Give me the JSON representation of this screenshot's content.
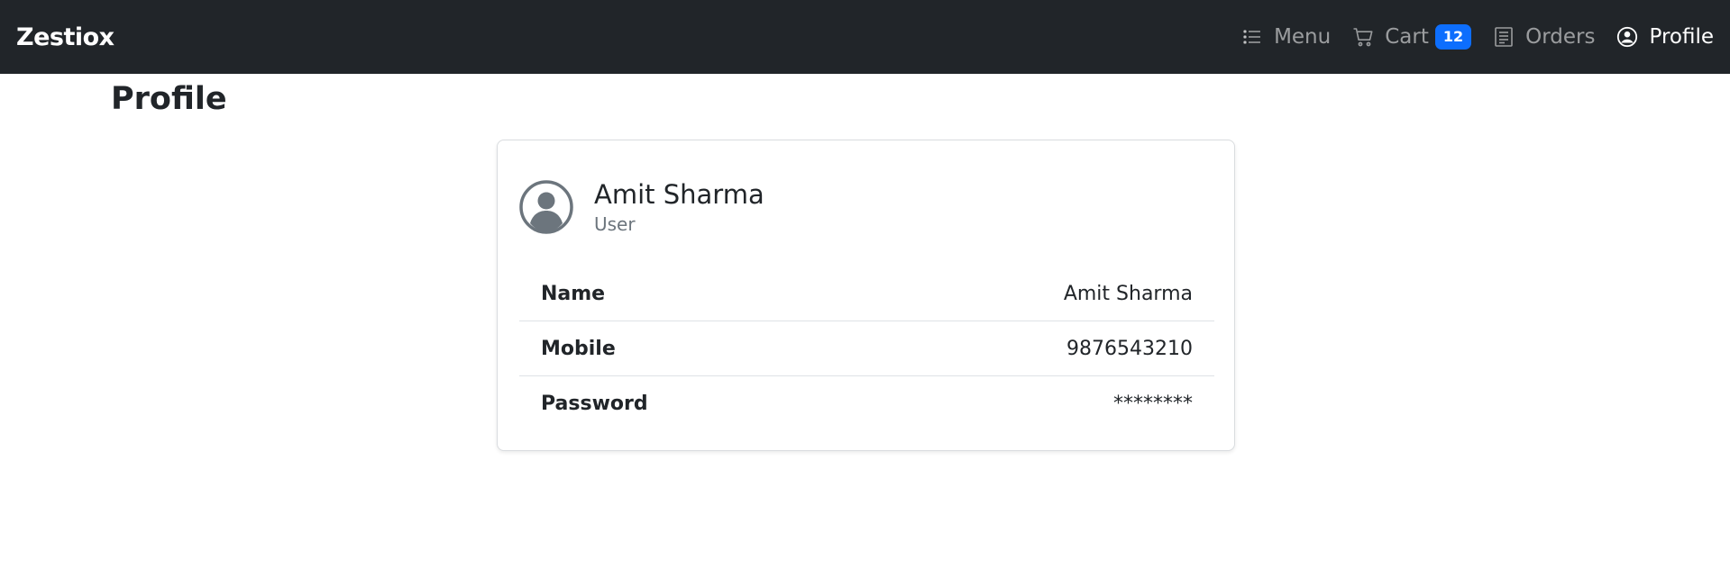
{
  "navbar": {
    "brand": "Zestiox",
    "items": [
      {
        "label": "Menu",
        "icon": "list-icon"
      },
      {
        "label": "Cart",
        "icon": "cart-icon",
        "badge": "12"
      },
      {
        "label": "Orders",
        "icon": "receipt-icon"
      },
      {
        "label": "Profile",
        "icon": "person-circle-icon",
        "active": true
      }
    ]
  },
  "page": {
    "title": "Profile"
  },
  "card": {
    "name": "Amit Sharma",
    "role": "User",
    "details": [
      {
        "label": "Name",
        "value": "Amit Sharma"
      },
      {
        "label": "Mobile",
        "value": "9876543210"
      },
      {
        "label": "Password",
        "value": "********"
      }
    ]
  },
  "colors": {
    "navbar_bg": "#212529",
    "badge_bg": "#0d6efd",
    "muted_text": "#6c757d"
  }
}
